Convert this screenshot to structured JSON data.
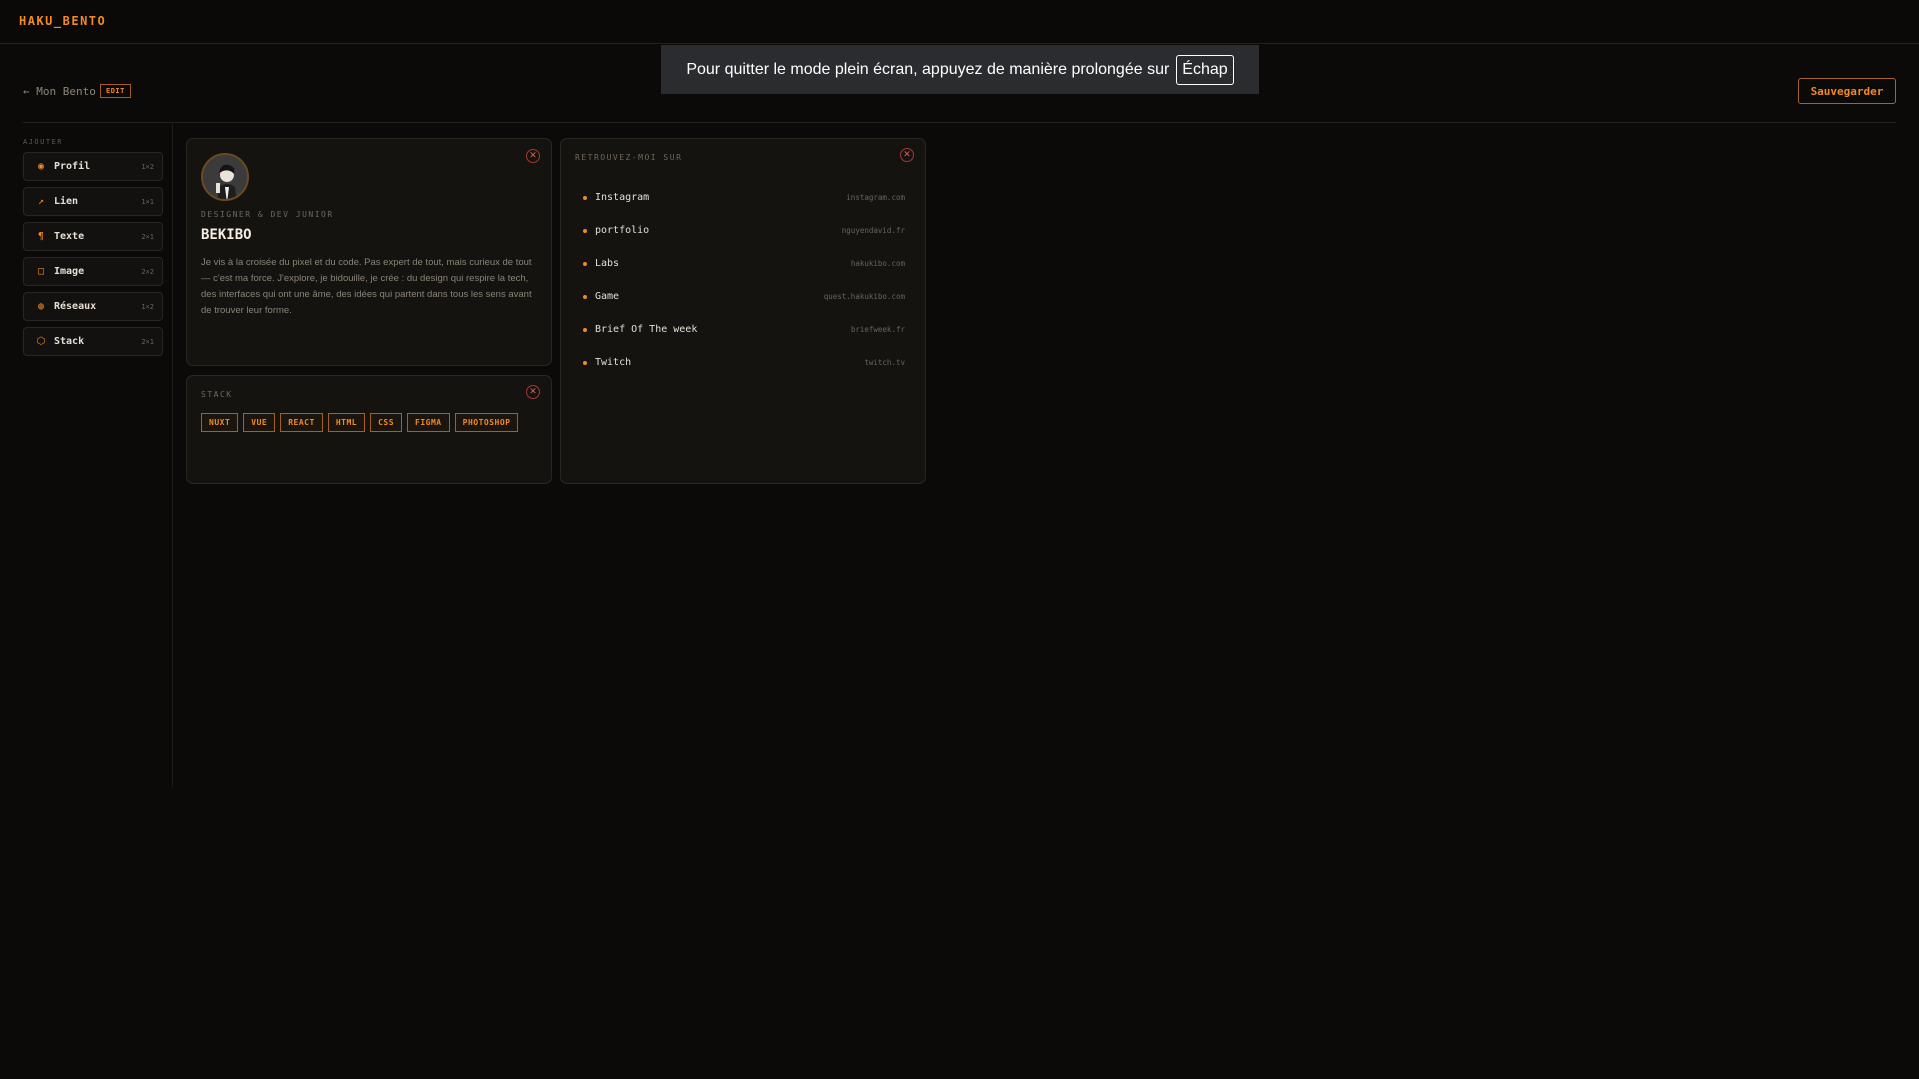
{
  "header": {
    "logo": "HAKU_BENTO"
  },
  "subheader": {
    "back_label": "← Mon Bento",
    "edit_badge": "EDIT",
    "save_label": "Sauvegarder"
  },
  "fullscreen_notice": {
    "text": "Pour quitter le mode plein écran, appuyez de manière prolongée sur",
    "key": "Échap"
  },
  "sidebar": {
    "title": "AJOUTER",
    "items": [
      {
        "icon": "profile-icon",
        "glyph": "◉",
        "label": "Profil",
        "size": "1×2"
      },
      {
        "icon": "link-icon",
        "glyph": "↗",
        "label": "Lien",
        "size": "1×1"
      },
      {
        "icon": "paragraph-icon",
        "glyph": "¶",
        "label": "Texte",
        "size": "2×1"
      },
      {
        "icon": "image-icon",
        "glyph": "□",
        "label": "Image",
        "size": "2×2"
      },
      {
        "icon": "network-icon",
        "glyph": "◍",
        "label": "Réseaux",
        "size": "1×2"
      },
      {
        "icon": "stack-icon",
        "glyph": "⬡",
        "label": "Stack",
        "size": "2×1"
      }
    ]
  },
  "profile_card": {
    "role": "DESIGNER & DEV JUNIOR",
    "name": "BEKIBO",
    "bio": "Je vis à la croisée du pixel et du code. Pas expert de tout, mais curieux de tout — c'est ma force. J'explore, je bidouille, je crée : du design qui respire la tech, des interfaces qui ont une âme, des idées qui partent dans tous les sens avant de trouver leur forme."
  },
  "stack_card": {
    "title": "STACK",
    "tags": [
      "NUXT",
      "VUE",
      "REACT",
      "HTML",
      "CSS",
      "FIGMA",
      "PHOTOSHOP"
    ]
  },
  "links_card": {
    "title": "RETROUVEZ-MOI SUR",
    "links": [
      {
        "label": "Instagram",
        "url": "instagram.com"
      },
      {
        "label": "portfolio",
        "url": "nguyendavid.fr"
      },
      {
        "label": "Labs",
        "url": "hakukibo.com"
      },
      {
        "label": "Game",
        "url": "quest.hakukibo.com"
      },
      {
        "label": "Brief Of The week",
        "url": "briefweek.fr"
      },
      {
        "label": "Twitch",
        "url": "twitch.tv"
      }
    ]
  },
  "colors": {
    "accent": "#f08a24",
    "background": "#0b0a09",
    "card": "#15130f",
    "close": "#e06060"
  }
}
